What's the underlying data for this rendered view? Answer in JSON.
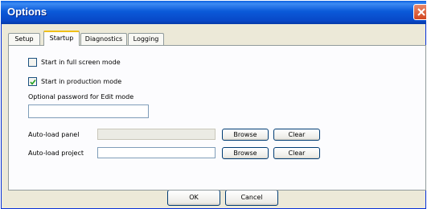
{
  "window": {
    "title": "Options"
  },
  "tabs": [
    {
      "label": "Setup"
    },
    {
      "label": "Startup"
    },
    {
      "label": "Diagnostics"
    },
    {
      "label": "Logging"
    }
  ],
  "active_tab": "Startup",
  "startup": {
    "full_screen": {
      "label": "Start in full screen mode",
      "checked": false
    },
    "production": {
      "label": "Start in production mode",
      "checked": true
    },
    "password": {
      "label": "Optional password for Edit mode",
      "value": ""
    },
    "autoload_panel": {
      "label": "Auto-load panel",
      "value": "",
      "enabled": false,
      "browse_label": "Browse",
      "clear_label": "Clear"
    },
    "autoload_project": {
      "label": "Auto-load project",
      "value": "",
      "enabled": true,
      "browse_label": "Browse",
      "clear_label": "Clear"
    }
  },
  "footer": {
    "ok_label": "OK",
    "cancel_label": "Cancel"
  }
}
